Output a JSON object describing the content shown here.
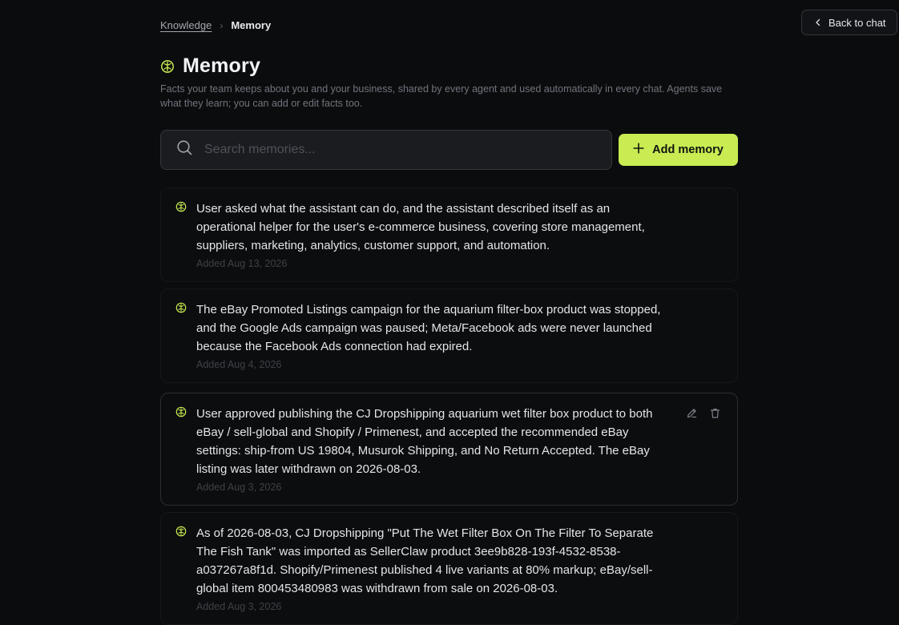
{
  "header": {
    "back_label": "Back to chat"
  },
  "breadcrumb": {
    "parent": "Knowledge",
    "current": "Memory"
  },
  "page": {
    "title": "Memory",
    "subtitle": "Facts your team keeps about you and your business, shared by every agent and used automatically in every chat. Agents save what they learn; you can add or edit facts too."
  },
  "search": {
    "placeholder": "Search memories...",
    "value": ""
  },
  "add_button": {
    "label": "Add memory"
  },
  "memories": [
    {
      "text": "User asked what the assistant can do, and the assistant described itself as an operational helper for the user's e-commerce business, covering store management, suppliers, marketing, analytics, customer support, and automation.",
      "date": "Added Aug 13, 2026"
    },
    {
      "text": "The eBay Promoted Listings campaign for the aquarium filter-box product was stopped, and the Google Ads campaign was paused; Meta/Facebook ads were never launched because the Facebook Ads connection had expired.",
      "date": "Added Aug 4, 2026"
    },
    {
      "text": "User approved publishing the CJ Dropshipping aquarium wet filter box product to both eBay / sell-global and Shopify / Primenest, and accepted the recommended eBay settings: ship-from US 19804, Musurok Shipping, and No Return Accepted. The eBay listing was later withdrawn on 2026-08-03.",
      "date": "Added Aug 3, 2026"
    },
    {
      "text": "As of 2026-08-03, CJ Dropshipping \"Put The Wet Filter Box On The Filter To Separate The Fish Tank\" was imported as SellerClaw product 3ee9b828-193f-4532-8538-a037267a8f1d. Shopify/Primenest published 4 live variants at 80% markup; eBay/sell-global item 800453480983 was withdrawn from sale on 2026-08-03.",
      "date": "Added Aug 3, 2026"
    }
  ],
  "colors": {
    "accent": "#c8ec52",
    "background": "#0b0c0e"
  },
  "icons": {
    "back": "chevron-left-icon",
    "title": "brain-icon",
    "search": "search-icon",
    "add": "plus-icon",
    "edit": "pencil-icon",
    "delete": "trash-icon"
  }
}
